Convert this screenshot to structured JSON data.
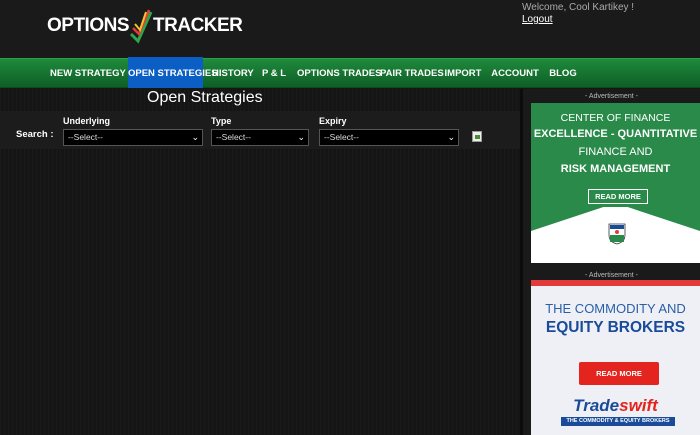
{
  "app": {
    "logo_left": "OPTIONS",
    "logo_right": "TRACKER",
    "welcome_text": "Welcome, Cool Kartikey !",
    "logout_label": "Logout"
  },
  "nav": {
    "items": [
      {
        "label": "NEW STRATEGY"
      },
      {
        "label": "OPEN STRATEGIES"
      },
      {
        "label": "HISTORY"
      },
      {
        "label": "P & L"
      },
      {
        "label": "OPTIONS TRADES"
      },
      {
        "label": "PAIR TRADES"
      },
      {
        "label": "IMPORT"
      },
      {
        "label": "ACCOUNT"
      },
      {
        "label": "BLOG"
      }
    ],
    "active": "OPEN STRATEGIES"
  },
  "main": {
    "title": "Open Strategies",
    "search_label": "Search :",
    "filters": {
      "underlying": {
        "label": "Underlying",
        "value": "--Select--"
      },
      "type": {
        "label": "Type",
        "value": "--Select--"
      },
      "expiry": {
        "label": "Expiry",
        "value": "--Select--"
      }
    }
  },
  "sidebar": {
    "ad1": {
      "label": "- Advertisement -",
      "line1": "CENTER OF FINANCE",
      "line2": "EXCELLENCE - QUANTITATIVE",
      "line3": "FINANCE AND",
      "line4": "RISK MANAGEMENT",
      "button": "READ MORE"
    },
    "ad2": {
      "label": "- Advertisement -",
      "line1": "THE COMMODITY AND",
      "line2": "EQUITY BROKERS",
      "button": "READ MORE",
      "brand_a": "Trade",
      "brand_b": "swift",
      "tagline": "THE COMMODITY & EQUITY BROKERS"
    }
  },
  "colors": {
    "nav_green": "#1f8a3c",
    "nav_active": "#0b5ec4",
    "ad1_green": "#2a8a4a",
    "ad2_red": "#e4241f",
    "ad2_blue": "#1a4b99"
  }
}
